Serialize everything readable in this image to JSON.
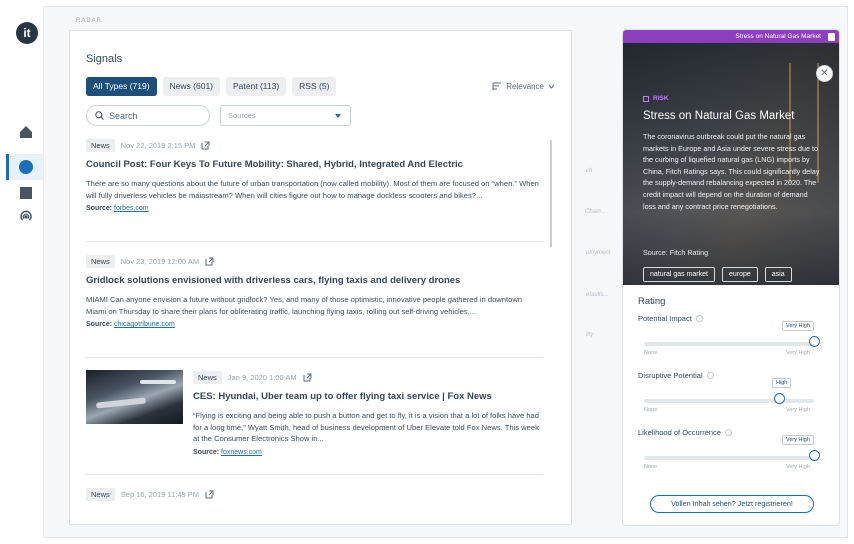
{
  "rail": {
    "logo_text": "it",
    "items": [
      "home-icon",
      "circle-icon",
      "square-icon",
      "signal-icon"
    ]
  },
  "breadcrumb": "RADAR",
  "signals": {
    "title": "Signals",
    "tabs": [
      {
        "label": "All Types (719)",
        "active": true
      },
      {
        "label": "News (601)",
        "active": false
      },
      {
        "label": "Patent (113)",
        "active": false
      },
      {
        "label": "RSS (5)",
        "active": false
      }
    ],
    "sort_label": "Relevance",
    "search_placeholder": "Search",
    "sources_placeholder": "Sources",
    "items": [
      {
        "type": "News",
        "date": "Nov 22, 2019 2:15 PM",
        "title": "Council Post: Four Keys To Future Mobility: Shared, Hybrid, Integrated And Electric",
        "description": "There are so many questions about the future of urban transportation (now called mobility). Most of them are focused on “when.” When will fully driverless vehicles be mainstream? When will cities figure out how to manage dockless scooters and bikes?...",
        "source_label": "Source:",
        "source": "forbes.com"
      },
      {
        "type": "News",
        "date": "Nov 23, 2019 12:00 AM",
        "title": "Gridlock solutions envisioned with driverless cars, flying taxis and delivery drones",
        "description": "MIAMI Can anyone envision a future without gridlock? Yes, and many of those optimistic, innovative people gathered in downtown Miami on Thursday to share their plans for obliterating traffic, launching flying taxis, rolling out self-driving vehicles,...",
        "source_label": "Source:",
        "source": "chicagotribune.com"
      },
      {
        "type": "News",
        "date": "Jan 9, 2020 1:00 AM",
        "title": "CES: Hyundai, Uber team up to offer flying taxi service | Fox News",
        "description": "“Flying is exciting and being able to push a button and get to fly, it is a vision that a lot of folks have had for a long time,” Wyatt Smith, head of business development of Uber Elevate told Fox News. This week at the Consumer Electronics Show in...",
        "source_label": "Source:",
        "source": "foxnews.com"
      },
      {
        "type": "News",
        "date": "Sep 16, 2019 11:49 PM"
      }
    ]
  },
  "background_labels": [
    "ch",
    "Chain...",
    "ployment",
    "efaults...",
    "lity"
  ],
  "popup": {
    "header": "Stress on Natural Gas Market",
    "category": "RISK",
    "title": "Stress on Natural Gas Market",
    "text": "The coronavirus outbreak could put the natural gas markets in Europe and Asia under severe stress due to the curbing of liquefied natural gas (LNG) imports by China, Fitch Ratings says. This could significantly delay the supply-demand rebalancing expected in 2020. The credit impact will depend on the duration of demand loss and any contract price renegotiations.",
    "source": "Source: Fitch Rating",
    "tags": [
      "natural gas market",
      "europe",
      "asia"
    ],
    "rating_title": "Rating",
    "metrics": [
      {
        "label": "Potential Impact",
        "value_label": "Very High",
        "level": 1.0,
        "min": "None",
        "max": "Very High"
      },
      {
        "label": "Disruptive Potential",
        "value_label": "High",
        "level": 0.8,
        "min": "None",
        "max": "Very High"
      },
      {
        "label": "Likelihood of Occurrence",
        "value_label": "Very High",
        "level": 1.0,
        "min": "None",
        "max": "Very High"
      }
    ],
    "cta": "Vollen Inhalt sehen? Jetzt registrieren!"
  },
  "colors": {
    "accent": "#1d4f7a",
    "risk_header": "#8b3fbf",
    "link": "#1b6fb8"
  }
}
